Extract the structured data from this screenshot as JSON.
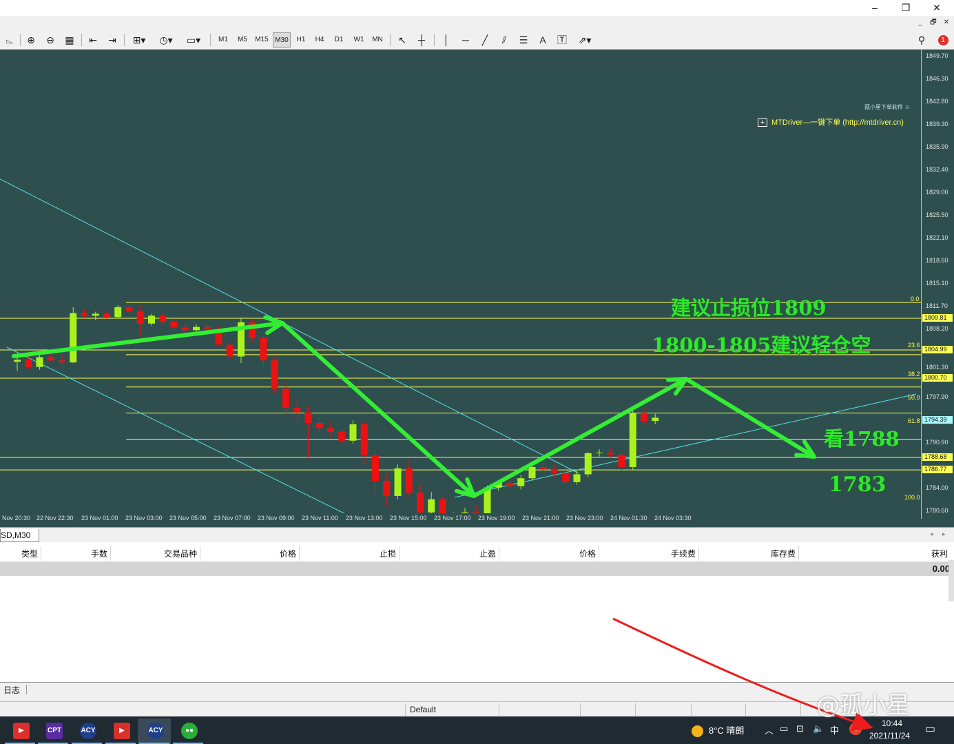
{
  "window": {
    "minimize": "–",
    "restore": "❐",
    "close": "✕",
    "mdi_min": "_",
    "mdi_restore": "🗗",
    "mdi_close": "✕"
  },
  "toolbar": {
    "timeframes": [
      "M1",
      "M5",
      "M15",
      "M30",
      "H1",
      "H4",
      "D1",
      "W1",
      "MN"
    ],
    "active_timeframe": "M30",
    "text_tool": "A",
    "notification_count": "1"
  },
  "chart": {
    "symbol_tab": "SD,M30",
    "plugin_label": "MTDriver—一键下单 (http://mtdriver.cn)",
    "plugin_box": "+",
    "corner_label": "孤小星下单软件",
    "price_axis": [
      "1849.70",
      "1846.30",
      "1842.80",
      "1839.30",
      "1835.90",
      "1832.40",
      "1829.00",
      "1825.50",
      "1822.10",
      "1818.60",
      "1815.10",
      "1811.70",
      "1808.20",
      "1801.30",
      "1797.90",
      "1790.90",
      "1784.00",
      "1780.60"
    ],
    "price_tags": [
      {
        "value": "1809.81",
        "style": "yellow"
      },
      {
        "value": "1804.99",
        "style": "yellow"
      },
      {
        "value": "1800.70",
        "style": "yellow"
      },
      {
        "value": "1794.39",
        "style": "cyan"
      },
      {
        "value": "1788.68",
        "style": "yellow"
      },
      {
        "value": "1786.77",
        "style": "yellow"
      }
    ],
    "fib_levels": [
      "0.0",
      "23.6",
      "38.2",
      "50.0",
      "61.8",
      "100.0"
    ],
    "time_axis": [
      "Nov 20:30",
      "22 Nov 22:30",
      "23 Nov 01:00",
      "23 Nov 03:00",
      "23 Nov 05:00",
      "23 Nov 07:00",
      "23 Nov 09:00",
      "23 Nov 11:00",
      "23 Nov 13:00",
      "23 Nov 15:00",
      "23 Nov 17:00",
      "23 Nov 19:00",
      "23 Nov 21:00",
      "23 Nov 23:00",
      "24 Nov 01:30",
      "24 Nov 03:30"
    ],
    "annotations": {
      "stop_loss": "建议止损位1809",
      "entry": "1800-1805建议轻仓空",
      "target1": "看1788",
      "target2": "1783"
    },
    "colors": {
      "bull": "#aaf21e",
      "bear": "#ee1111",
      "background": "#2f4f4f",
      "arrow": "#33ee33",
      "fib": "#ffff55",
      "trend": "#55e0e8"
    },
    "candles": [
      [
        1803.2,
        1804.1,
        1801.8,
        1803.5
      ],
      [
        1803.5,
        1804.0,
        1802.0,
        1802.4
      ],
      [
        1802.4,
        1804.2,
        1802.0,
        1803.9
      ],
      [
        1803.9,
        1804.5,
        1803.2,
        1803.4
      ],
      [
        1803.4,
        1804.3,
        1802.8,
        1803.1
      ],
      [
        1803.1,
        1811.5,
        1803.0,
        1810.6
      ],
      [
        1810.6,
        1811.2,
        1809.8,
        1810.2
      ],
      [
        1810.2,
        1810.8,
        1809.5,
        1810.5
      ],
      [
        1810.5,
        1811.0,
        1809.6,
        1810.0
      ],
      [
        1810.0,
        1811.8,
        1809.8,
        1811.5
      ],
      [
        1811.5,
        1811.9,
        1810.6,
        1810.9
      ],
      [
        1810.9,
        1811.7,
        1807.0,
        1809.0
      ],
      [
        1809.0,
        1810.5,
        1808.7,
        1810.2
      ],
      [
        1810.2,
        1810.6,
        1808.9,
        1809.3
      ],
      [
        1809.3,
        1809.9,
        1807.9,
        1808.4
      ],
      [
        1808.4,
        1809.0,
        1807.5,
        1808.0
      ],
      [
        1808.0,
        1808.9,
        1807.8,
        1808.5
      ],
      [
        1808.5,
        1809.0,
        1807.8,
        1808.2
      ],
      [
        1808.2,
        1808.6,
        1805.6,
        1805.8
      ],
      [
        1805.8,
        1806.2,
        1803.4,
        1804.0
      ],
      [
        1804.0,
        1809.9,
        1803.0,
        1809.2
      ],
      [
        1809.2,
        1809.6,
        1806.2,
        1806.8
      ],
      [
        1806.8,
        1807.1,
        1802.5,
        1803.4
      ],
      [
        1803.4,
        1804.0,
        1798.4,
        1799.1
      ],
      [
        1799.1,
        1800.3,
        1795.3,
        1796.2
      ],
      [
        1796.2,
        1797.8,
        1794.4,
        1795.5
      ],
      [
        1795.5,
        1796.5,
        1788.5,
        1793.9
      ],
      [
        1793.9,
        1794.7,
        1792.5,
        1793.1
      ],
      [
        1793.1,
        1794.1,
        1791.8,
        1792.6
      ],
      [
        1792.6,
        1793.0,
        1790.6,
        1791.2
      ],
      [
        1791.2,
        1794.3,
        1790.8,
        1793.7
      ],
      [
        1793.7,
        1794.2,
        1787.6,
        1789.0
      ],
      [
        1789.0,
        1789.8,
        1783.0,
        1785.1
      ],
      [
        1785.1,
        1786.2,
        1781.2,
        1782.8
      ],
      [
        1782.8,
        1787.6,
        1782.3,
        1787.0
      ],
      [
        1787.0,
        1788.2,
        1782.5,
        1783.3
      ],
      [
        1783.3,
        1784.6,
        1779.9,
        1780.3
      ],
      [
        1780.3,
        1783.4,
        1779.8,
        1782.3
      ],
      [
        1782.3,
        1782.7,
        1777.4,
        1777.9
      ],
      [
        1777.9,
        1780.3,
        1777.1,
        1779.6
      ],
      [
        1779.6,
        1781.0,
        1778.5,
        1780.3
      ],
      [
        1780.3,
        1781.4,
        1777.2,
        1778.4
      ],
      [
        1778.4,
        1784.4,
        1778.0,
        1784.1
      ],
      [
        1784.1,
        1785.2,
        1783.6,
        1784.8
      ],
      [
        1784.8,
        1785.6,
        1783.9,
        1784.3
      ],
      [
        1784.3,
        1786.0,
        1783.8,
        1785.5
      ],
      [
        1785.5,
        1787.8,
        1785.1,
        1787.2
      ],
      [
        1787.2,
        1788.4,
        1786.5,
        1786.9
      ],
      [
        1786.9,
        1787.6,
        1785.7,
        1786.3
      ],
      [
        1786.3,
        1786.7,
        1784.6,
        1784.9
      ],
      [
        1784.9,
        1786.8,
        1784.5,
        1786.1
      ],
      [
        1786.1,
        1789.5,
        1785.7,
        1789.3
      ],
      [
        1789.3,
        1789.9,
        1788.8,
        1789.4
      ],
      [
        1789.4,
        1790.0,
        1788.6,
        1789.1
      ],
      [
        1789.1,
        1789.5,
        1786.6,
        1787.2
      ],
      [
        1787.2,
        1796.0,
        1786.8,
        1795.4
      ],
      [
        1795.4,
        1796.3,
        1793.6,
        1794.2
      ],
      [
        1794.2,
        1795.3,
        1793.7,
        1794.7
      ]
    ]
  },
  "terminal": {
    "columns": [
      "类型",
      "手数",
      "交易品种",
      "价格",
      "止损",
      "止盈",
      "价格",
      "手续费",
      "库存费",
      "获利"
    ],
    "balance": "0.00",
    "log_tab": "日志",
    "profile": "Default"
  },
  "taskbar": {
    "apps": [
      {
        "name": "red-app-1",
        "label": "▶",
        "color": "#d9302c"
      },
      {
        "name": "cpt-app",
        "label": "CPT",
        "color": "#5a2ca0"
      },
      {
        "name": "acy-app-1",
        "label": "ACY",
        "color": "#1f3f8a"
      },
      {
        "name": "red-app-2",
        "label": "▶",
        "color": "#d9302c"
      },
      {
        "name": "acy-app-2",
        "label": "ACY",
        "color": "#1f3f8a"
      },
      {
        "name": "wechat-app",
        "label": "●●",
        "color": "#2aae37"
      }
    ],
    "weather": "8°C 晴朗",
    "ime": "中",
    "time": "10:44",
    "date": "2021/11/24"
  },
  "watermark": "@孤小星"
}
